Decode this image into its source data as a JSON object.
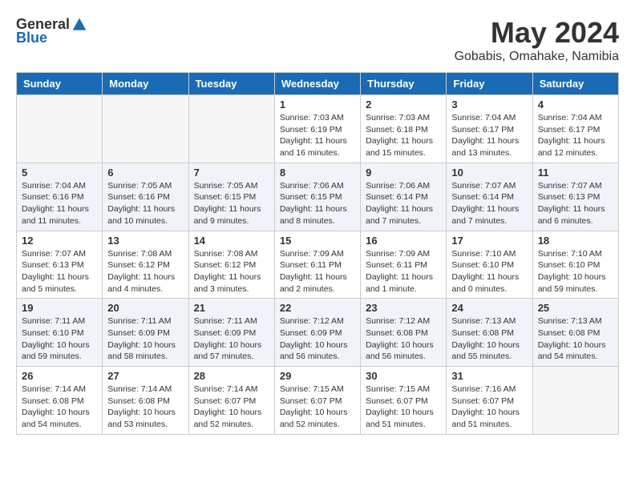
{
  "header": {
    "logo_general": "General",
    "logo_blue": "Blue",
    "title": "May 2024",
    "location": "Gobabis, Omahake, Namibia"
  },
  "days_of_week": [
    "Sunday",
    "Monday",
    "Tuesday",
    "Wednesday",
    "Thursday",
    "Friday",
    "Saturday"
  ],
  "weeks": [
    {
      "days": [
        {
          "number": "",
          "info": ""
        },
        {
          "number": "",
          "info": ""
        },
        {
          "number": "",
          "info": ""
        },
        {
          "number": "1",
          "info": "Sunrise: 7:03 AM\nSunset: 6:19 PM\nDaylight: 11 hours and 16 minutes."
        },
        {
          "number": "2",
          "info": "Sunrise: 7:03 AM\nSunset: 6:18 PM\nDaylight: 11 hours and 15 minutes."
        },
        {
          "number": "3",
          "info": "Sunrise: 7:04 AM\nSunset: 6:17 PM\nDaylight: 11 hours and 13 minutes."
        },
        {
          "number": "4",
          "info": "Sunrise: 7:04 AM\nSunset: 6:17 PM\nDaylight: 11 hours and 12 minutes."
        }
      ]
    },
    {
      "days": [
        {
          "number": "5",
          "info": "Sunrise: 7:04 AM\nSunset: 6:16 PM\nDaylight: 11 hours and 11 minutes."
        },
        {
          "number": "6",
          "info": "Sunrise: 7:05 AM\nSunset: 6:16 PM\nDaylight: 11 hours and 10 minutes."
        },
        {
          "number": "7",
          "info": "Sunrise: 7:05 AM\nSunset: 6:15 PM\nDaylight: 11 hours and 9 minutes."
        },
        {
          "number": "8",
          "info": "Sunrise: 7:06 AM\nSunset: 6:15 PM\nDaylight: 11 hours and 8 minutes."
        },
        {
          "number": "9",
          "info": "Sunrise: 7:06 AM\nSunset: 6:14 PM\nDaylight: 11 hours and 7 minutes."
        },
        {
          "number": "10",
          "info": "Sunrise: 7:07 AM\nSunset: 6:14 PM\nDaylight: 11 hours and 7 minutes."
        },
        {
          "number": "11",
          "info": "Sunrise: 7:07 AM\nSunset: 6:13 PM\nDaylight: 11 hours and 6 minutes."
        }
      ]
    },
    {
      "days": [
        {
          "number": "12",
          "info": "Sunrise: 7:07 AM\nSunset: 6:13 PM\nDaylight: 11 hours and 5 minutes."
        },
        {
          "number": "13",
          "info": "Sunrise: 7:08 AM\nSunset: 6:12 PM\nDaylight: 11 hours and 4 minutes."
        },
        {
          "number": "14",
          "info": "Sunrise: 7:08 AM\nSunset: 6:12 PM\nDaylight: 11 hours and 3 minutes."
        },
        {
          "number": "15",
          "info": "Sunrise: 7:09 AM\nSunset: 6:11 PM\nDaylight: 11 hours and 2 minutes."
        },
        {
          "number": "16",
          "info": "Sunrise: 7:09 AM\nSunset: 6:11 PM\nDaylight: 11 hours and 1 minute."
        },
        {
          "number": "17",
          "info": "Sunrise: 7:10 AM\nSunset: 6:10 PM\nDaylight: 11 hours and 0 minutes."
        },
        {
          "number": "18",
          "info": "Sunrise: 7:10 AM\nSunset: 6:10 PM\nDaylight: 10 hours and 59 minutes."
        }
      ]
    },
    {
      "days": [
        {
          "number": "19",
          "info": "Sunrise: 7:11 AM\nSunset: 6:10 PM\nDaylight: 10 hours and 59 minutes."
        },
        {
          "number": "20",
          "info": "Sunrise: 7:11 AM\nSunset: 6:09 PM\nDaylight: 10 hours and 58 minutes."
        },
        {
          "number": "21",
          "info": "Sunrise: 7:11 AM\nSunset: 6:09 PM\nDaylight: 10 hours and 57 minutes."
        },
        {
          "number": "22",
          "info": "Sunrise: 7:12 AM\nSunset: 6:09 PM\nDaylight: 10 hours and 56 minutes."
        },
        {
          "number": "23",
          "info": "Sunrise: 7:12 AM\nSunset: 6:08 PM\nDaylight: 10 hours and 56 minutes."
        },
        {
          "number": "24",
          "info": "Sunrise: 7:13 AM\nSunset: 6:08 PM\nDaylight: 10 hours and 55 minutes."
        },
        {
          "number": "25",
          "info": "Sunrise: 7:13 AM\nSunset: 6:08 PM\nDaylight: 10 hours and 54 minutes."
        }
      ]
    },
    {
      "days": [
        {
          "number": "26",
          "info": "Sunrise: 7:14 AM\nSunset: 6:08 PM\nDaylight: 10 hours and 54 minutes."
        },
        {
          "number": "27",
          "info": "Sunrise: 7:14 AM\nSunset: 6:08 PM\nDaylight: 10 hours and 53 minutes."
        },
        {
          "number": "28",
          "info": "Sunrise: 7:14 AM\nSunset: 6:07 PM\nDaylight: 10 hours and 52 minutes."
        },
        {
          "number": "29",
          "info": "Sunrise: 7:15 AM\nSunset: 6:07 PM\nDaylight: 10 hours and 52 minutes."
        },
        {
          "number": "30",
          "info": "Sunrise: 7:15 AM\nSunset: 6:07 PM\nDaylight: 10 hours and 51 minutes."
        },
        {
          "number": "31",
          "info": "Sunrise: 7:16 AM\nSunset: 6:07 PM\nDaylight: 10 hours and 51 minutes."
        },
        {
          "number": "",
          "info": ""
        }
      ]
    }
  ]
}
